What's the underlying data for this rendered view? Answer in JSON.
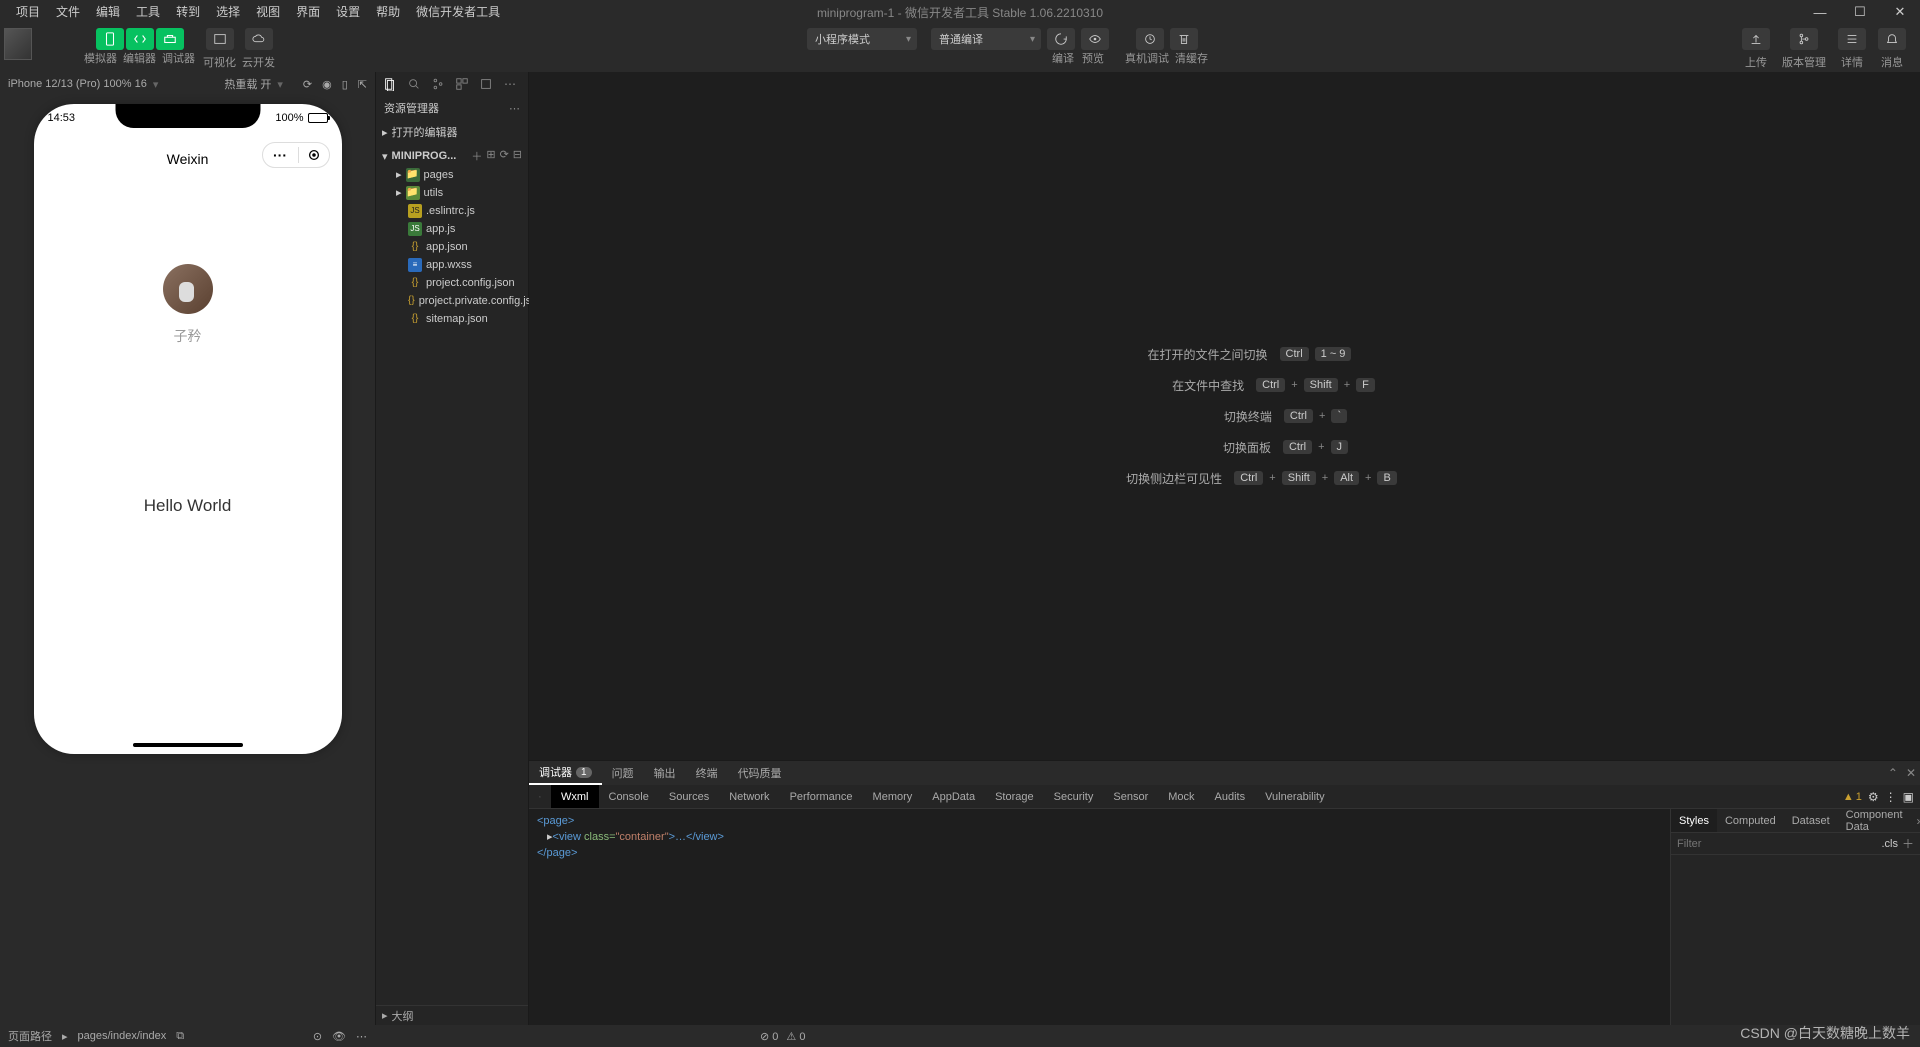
{
  "window_title": "miniprogram-1 - 微信开发者工具 Stable 1.06.2210310",
  "menubar": [
    "项目",
    "文件",
    "编辑",
    "工具",
    "转到",
    "选择",
    "视图",
    "界面",
    "设置",
    "帮助",
    "微信开发者工具"
  ],
  "toolbar": {
    "groups": {
      "simulator": "模拟器",
      "editor": "编辑器",
      "debugger": "调试器",
      "visual": "可视化",
      "cloud": "云开发"
    },
    "mode_dropdown": "小程序模式",
    "compile_dropdown": "普通编译",
    "compile": "编译",
    "preview": "预览",
    "real_device": "真机调试",
    "clear_cache": "清缓存",
    "upload": "上传",
    "version": "版本管理",
    "details": "详情",
    "notify": "消息"
  },
  "simulator": {
    "device_info": "iPhone 12/13 (Pro) 100% 16",
    "hot_reload": "热重载 开",
    "status_time": "14:53",
    "battery_pct": "100%",
    "app_title": "Weixin",
    "user_name": "子矜",
    "hello": "Hello World"
  },
  "explorer": {
    "title": "资源管理器",
    "open_editors": "打开的编辑器",
    "project": "MINIPROG...",
    "files": {
      "pages": "pages",
      "utils": "utils",
      "eslint": ".eslintrc.js",
      "appjs": "app.js",
      "appjson": "app.json",
      "appwxss": "app.wxss",
      "projconf": "project.config.json",
      "projpriv": "project.private.config.js...",
      "sitemap": "sitemap.json"
    },
    "outline": "大纲"
  },
  "shortcuts": [
    {
      "label": "在打开的文件之间切换",
      "keys": [
        "Ctrl",
        "1 ~ 9"
      ]
    },
    {
      "label": "在文件中查找",
      "keys": [
        "Ctrl",
        "Shift",
        "F"
      ]
    },
    {
      "label": "切换终端",
      "keys": [
        "Ctrl",
        "`"
      ]
    },
    {
      "label": "切换面板",
      "keys": [
        "Ctrl",
        "J"
      ]
    },
    {
      "label": "切换侧边栏可见性",
      "keys": [
        "Ctrl",
        "Shift",
        "Alt",
        "B"
      ]
    }
  ],
  "debugger": {
    "top_tabs": {
      "debugger": "调试器",
      "badge": "1",
      "problems": "问题",
      "output": "输出",
      "terminal": "终端",
      "code_quality": "代码质量"
    },
    "tabs": [
      "Wxml",
      "Console",
      "Sources",
      "Network",
      "Performance",
      "Memory",
      "AppData",
      "Storage",
      "Security",
      "Sensor",
      "Mock",
      "Audits",
      "Vulnerability"
    ],
    "active_tab": "Wxml",
    "warn_count": "1",
    "wxml": {
      "open_page": "<page>",
      "view_open": "<view ",
      "class_attr": "class=",
      "class_val": "\"container\"",
      "view_rest": ">…</view>",
      "close_page": "</page>"
    },
    "styles_tabs": [
      "Styles",
      "Computed",
      "Dataset",
      "Component Data"
    ],
    "filter_placeholder": "Filter",
    "cls_label": ".cls"
  },
  "statusbar": {
    "page_path_label": "页面路径",
    "page_path": "pages/index/index",
    "errors": "0",
    "warnings": "0"
  },
  "watermark": "CSDN @白天数糖晚上数羊"
}
